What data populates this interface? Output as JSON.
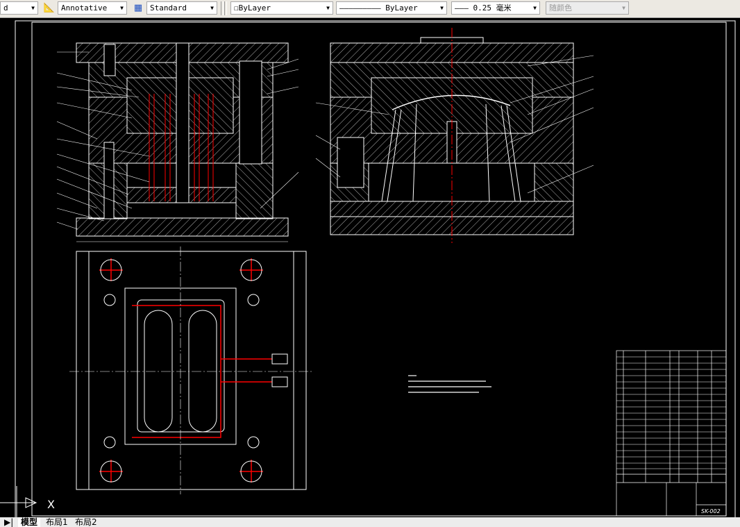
{
  "toolbar": {
    "text_style_partial": "d",
    "dim_style": "Annotative",
    "table_style": "Standard",
    "layer_color": "ByLayer",
    "linetype": "ByLayer",
    "lineweight": "0.25 毫米",
    "plot_style": "随颜色"
  },
  "drawing": {
    "drawing_number": "SK-002",
    "colors": {
      "background": "#000000",
      "lines": "#ffffff",
      "centerline": "#ff0000"
    }
  },
  "tabs": [
    {
      "label": "模型",
      "active": true
    },
    {
      "label": "布局1",
      "active": false
    },
    {
      "label": "布局2",
      "active": false
    }
  ],
  "ucs_icon": {
    "axis_label": "X"
  }
}
